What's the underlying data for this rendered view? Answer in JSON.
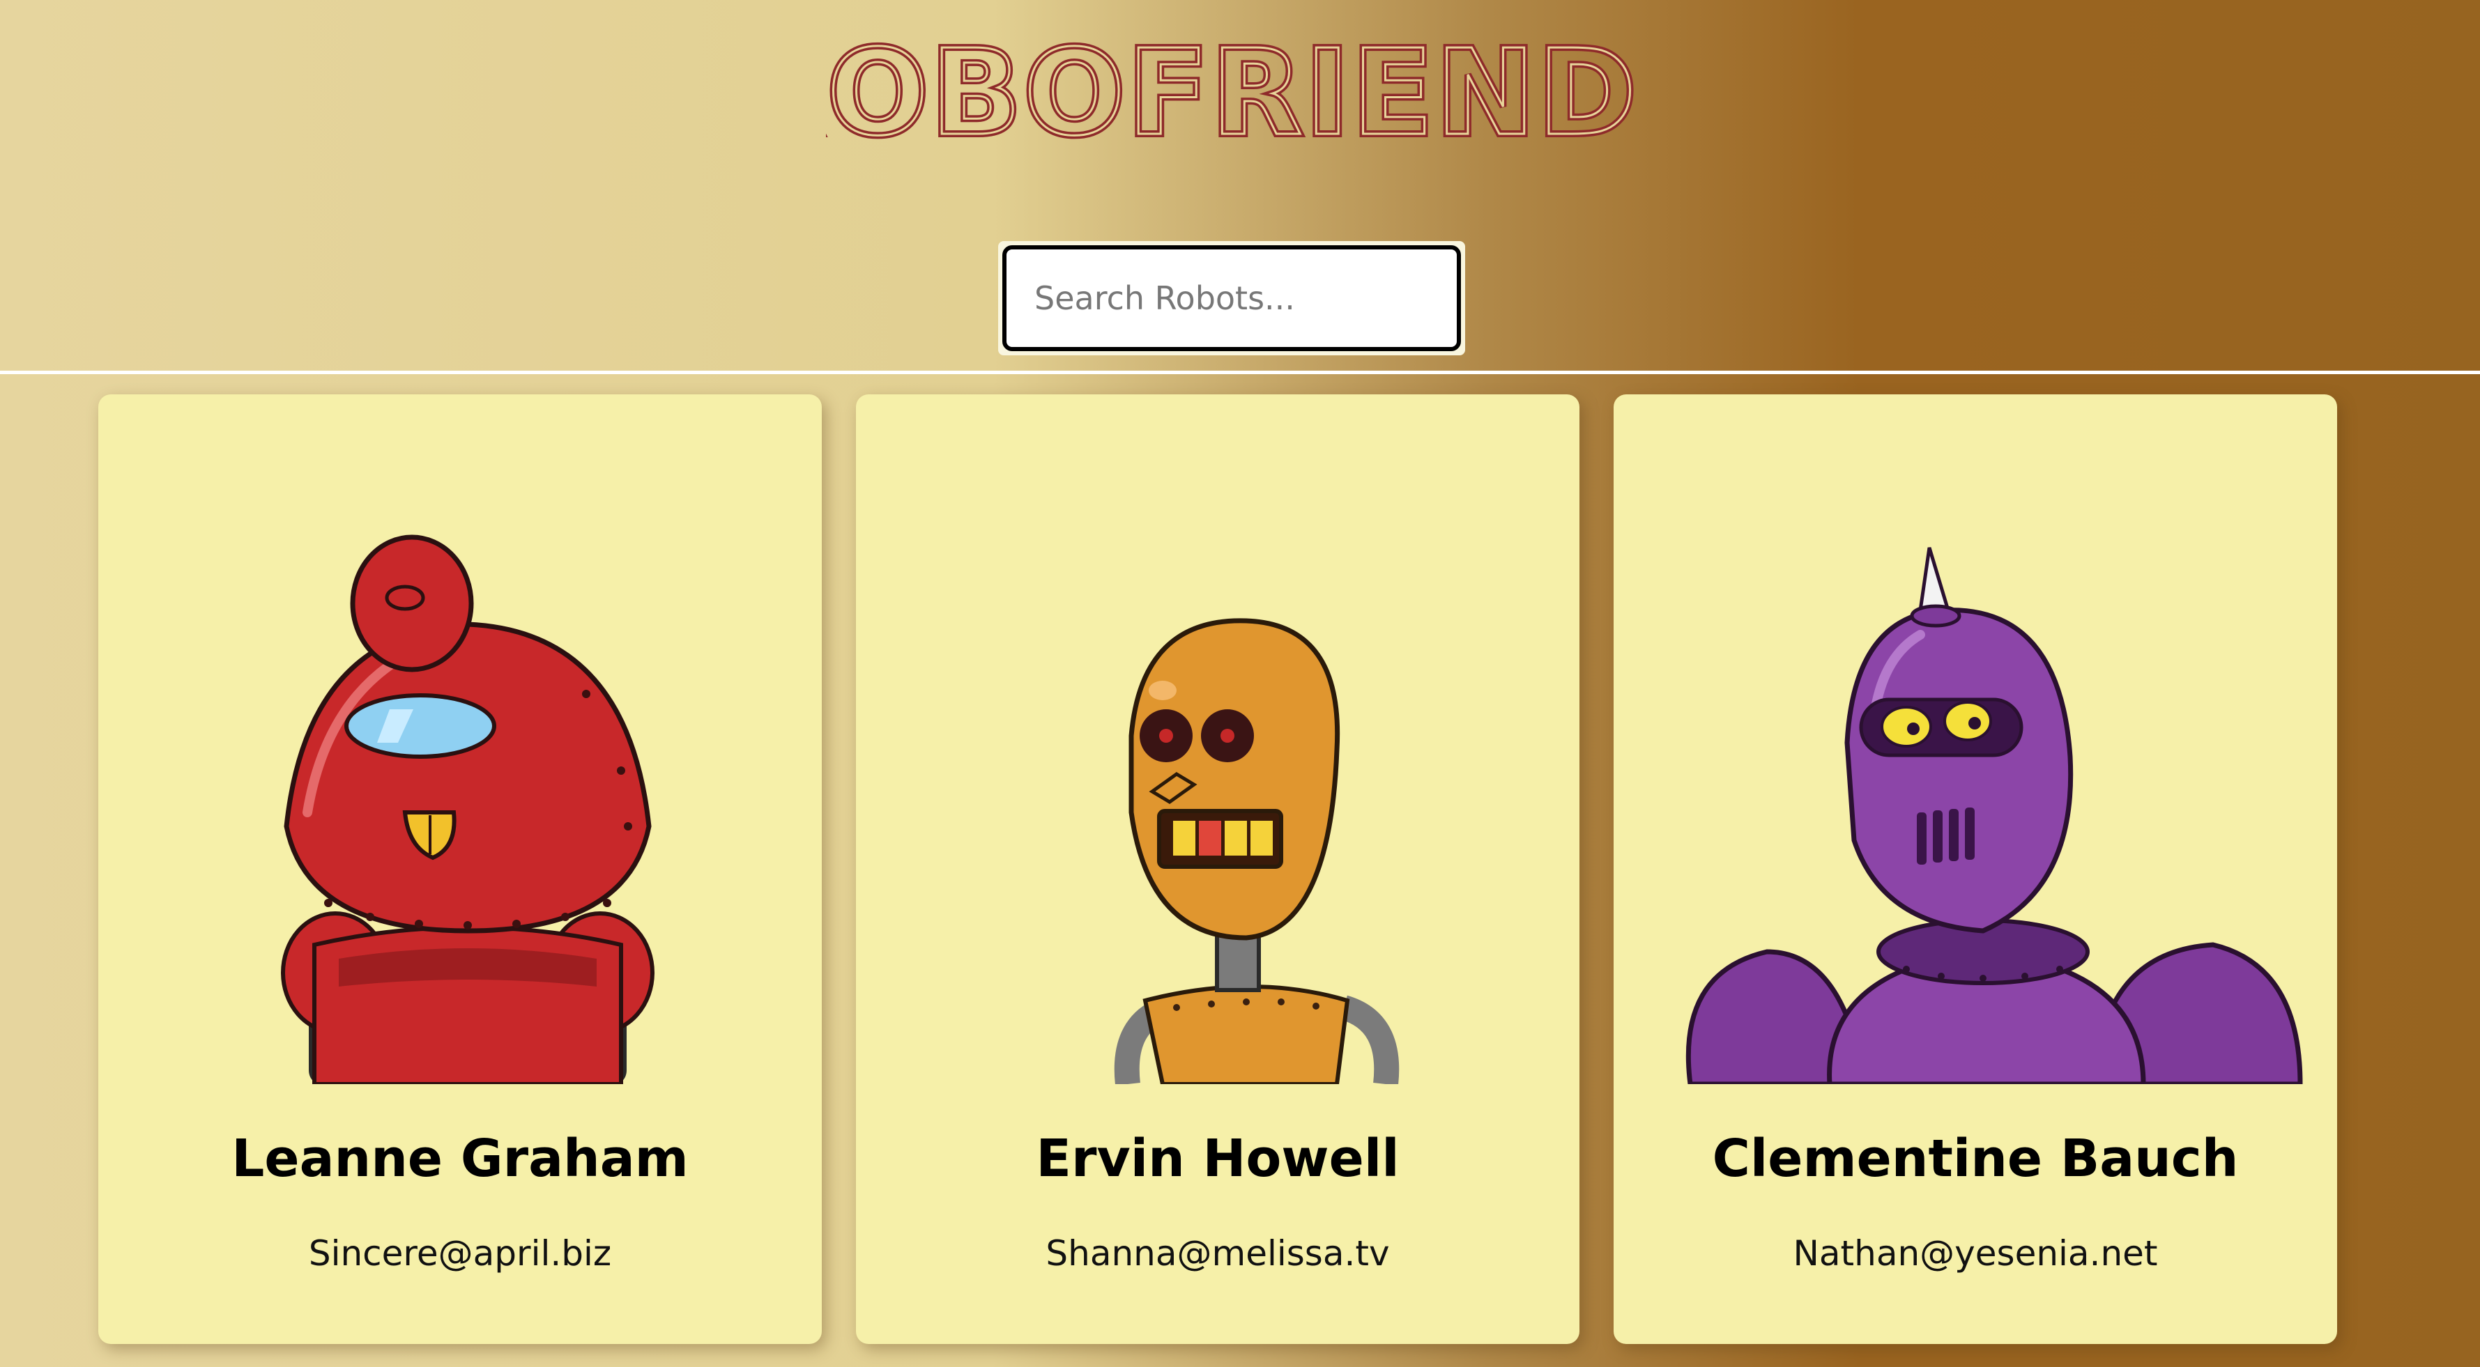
{
  "app": {
    "title": "ROBOFRIENDS",
    "title_color": "#8e2a2a"
  },
  "search": {
    "placeholder": "Search Robots...",
    "value": ""
  },
  "robots": [
    {
      "name": "Leanne Graham",
      "email": "Sincere@april.biz",
      "color": "red"
    },
    {
      "name": "Ervin Howell",
      "email": "Shanna@melissa.tv",
      "color": "orange"
    },
    {
      "name": "Clementine Bauch",
      "email": "Nathan@yesenia.net",
      "color": "purple"
    }
  ],
  "colors": {
    "card_background": "#f6f0a9",
    "title": "#8e2a2a"
  }
}
